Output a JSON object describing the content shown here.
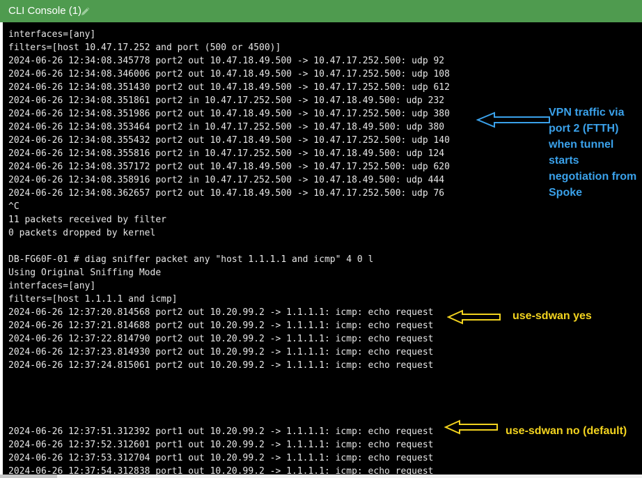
{
  "window": {
    "title": "CLI Console (1)"
  },
  "console": {
    "lines": [
      "interfaces=[any]",
      "filters=[host 10.47.17.252 and port (500 or 4500)]",
      "2024-06-26 12:34:08.345778 port2 out 10.47.18.49.500 -> 10.47.17.252.500: udp 92",
      "2024-06-26 12:34:08.346006 port2 out 10.47.18.49.500 -> 10.47.17.252.500: udp 108",
      "2024-06-26 12:34:08.351430 port2 out 10.47.18.49.500 -> 10.47.17.252.500: udp 612",
      "2024-06-26 12:34:08.351861 port2 in 10.47.17.252.500 -> 10.47.18.49.500: udp 232",
      "2024-06-26 12:34:08.351986 port2 out 10.47.18.49.500 -> 10.47.17.252.500: udp 380",
      "2024-06-26 12:34:08.353464 port2 in 10.47.17.252.500 -> 10.47.18.49.500: udp 380",
      "2024-06-26 12:34:08.355432 port2 out 10.47.18.49.500 -> 10.47.17.252.500: udp 140",
      "2024-06-26 12:34:08.355816 port2 in 10.47.17.252.500 -> 10.47.18.49.500: udp 124",
      "2024-06-26 12:34:08.357172 port2 out 10.47.18.49.500 -> 10.47.17.252.500: udp 620",
      "2024-06-26 12:34:08.358916 port2 in 10.47.17.252.500 -> 10.47.18.49.500: udp 444",
      "2024-06-26 12:34:08.362657 port2 out 10.47.18.49.500 -> 10.47.17.252.500: udp 76",
      "^C",
      "11 packets received by filter",
      "0 packets dropped by kernel",
      "",
      "DB-FG60F-01 # diag sniffer packet any \"host 1.1.1.1 and icmp\" 4 0 l",
      "Using Original Sniffing Mode",
      "interfaces=[any]",
      "filters=[host 1.1.1.1 and icmp]",
      "2024-06-26 12:37:20.814568 port2 out 10.20.99.2 -> 1.1.1.1: icmp: echo request",
      "2024-06-26 12:37:21.814688 port2 out 10.20.99.2 -> 1.1.1.1: icmp: echo request",
      "2024-06-26 12:37:22.814790 port2 out 10.20.99.2 -> 1.1.1.1: icmp: echo request",
      "2024-06-26 12:37:23.814930 port2 out 10.20.99.2 -> 1.1.1.1: icmp: echo request",
      "2024-06-26 12:37:24.815061 port2 out 10.20.99.2 -> 1.1.1.1: icmp: echo request",
      "",
      "",
      "",
      "",
      "2024-06-26 12:37:51.312392 port1 out 10.20.99.2 -> 1.1.1.1: icmp: echo request",
      "2024-06-26 12:37:52.312601 port1 out 10.20.99.2 -> 1.1.1.1: icmp: echo request",
      "2024-06-26 12:37:53.312704 port1 out 10.20.99.2 -> 1.1.1.1: icmp: echo request",
      "2024-06-26 12:37:54.312838 port1 out 10.20.99.2 -> 1.1.1.1: icmp: echo request"
    ]
  },
  "annotations": {
    "vpn_note": [
      "VPN traffic via",
      "port 2 (FTTH)",
      "when tunnel",
      "starts",
      "negotiation from",
      "Spoke"
    ],
    "sdwan_yes": "use-sdwan yes",
    "sdwan_no": "use-sdwan no (default)"
  },
  "colors": {
    "titlebar": "#4f9b4f",
    "console_bg": "#000000",
    "console_text": "#e6e6e6",
    "annotation_blue": "#3aa1ea",
    "annotation_yellow": "#f2d31f"
  },
  "icons": {
    "edit": "pencil-icon"
  }
}
